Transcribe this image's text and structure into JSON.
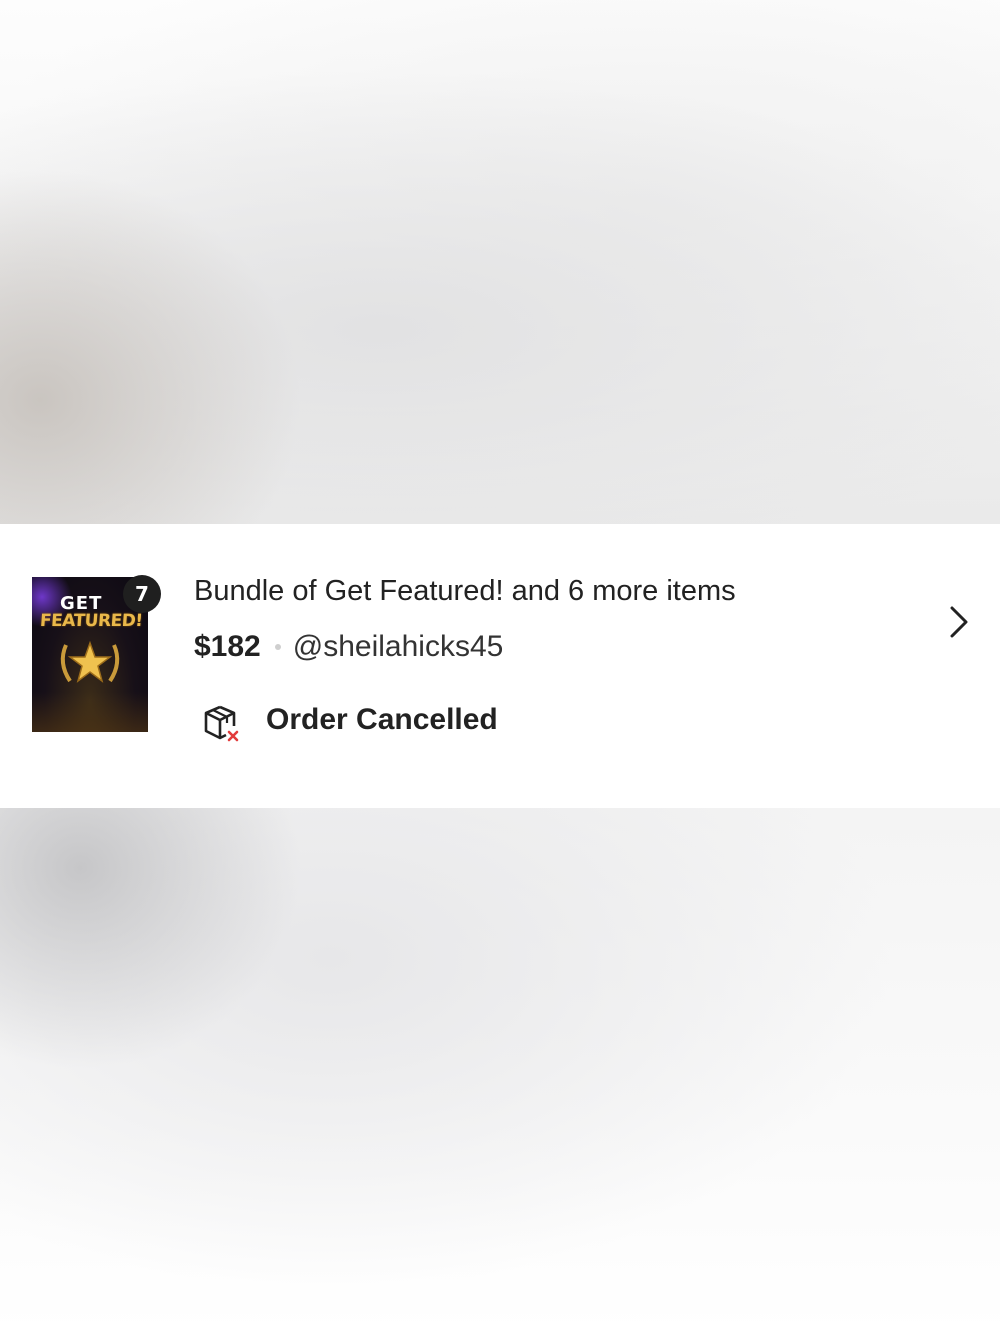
{
  "order": {
    "thumbnail": {
      "line1": "GET",
      "line2": "FEATURED!",
      "icon": "gold-star-laurel-icon"
    },
    "item_count_badge": "7",
    "title": "Bundle of Get Featured! and 6 more items",
    "price": "$182",
    "seller": "@sheilahicks45",
    "status": {
      "icon": "package-cancelled-icon",
      "label": "Order Cancelled",
      "icon_accent_color": "#e23b3b"
    },
    "navigation_icon": "chevron-right-icon"
  },
  "colors": {
    "text_primary": "#222222",
    "badge_background": "#1f1f1f",
    "thumbnail_gold": "#e9b84a"
  }
}
